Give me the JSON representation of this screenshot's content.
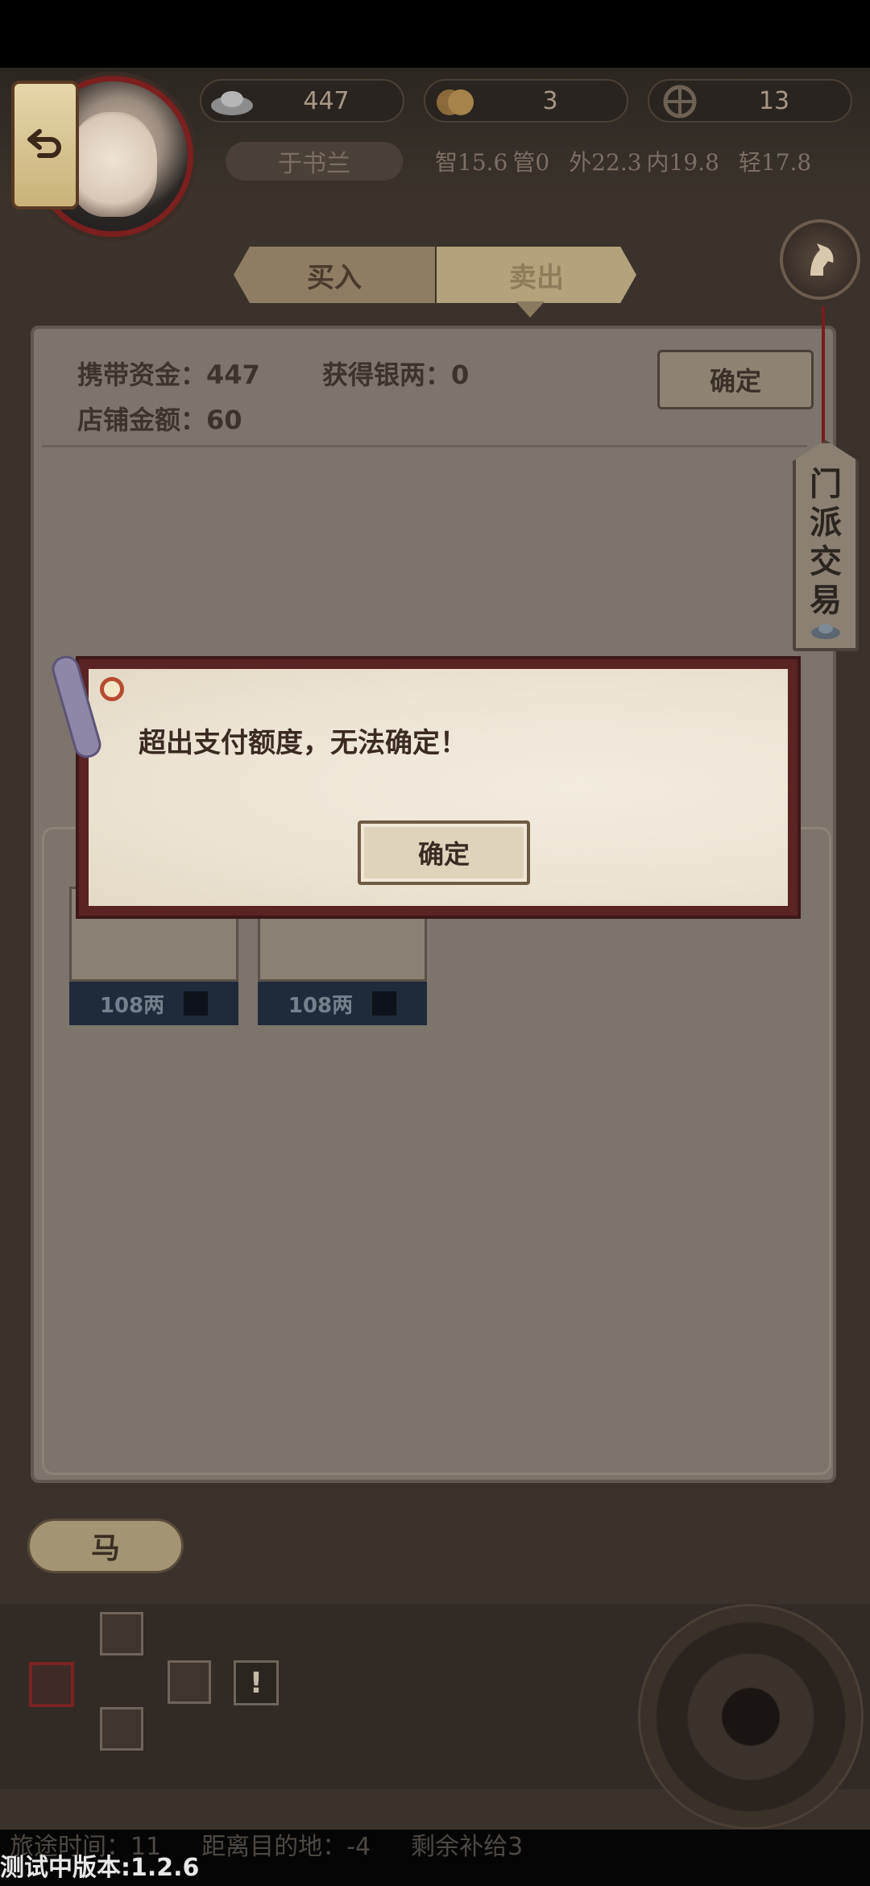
{
  "header": {
    "silver": "447",
    "coins": "3",
    "wheel": "13",
    "player_name": "于书兰",
    "stats": [
      "智15.6",
      "管0",
      "外22.3",
      "内19.8",
      "轻17.8"
    ]
  },
  "tabs": {
    "buy": "买入",
    "sell": "卖出"
  },
  "panel": {
    "carry_funds": "携带资金：447",
    "gain_silver": "获得银两：0",
    "shop_amount": "店铺金额：60",
    "confirm": "确定"
  },
  "side_tag": [
    "门",
    "派",
    "交",
    "易"
  ],
  "items": [
    {
      "price": "108两"
    },
    {
      "price": "108两"
    }
  ],
  "horse_tab": "马",
  "route": {
    "warning": "!"
  },
  "footer": {
    "travel_time": "旅途时间：11",
    "distance": "距离目的地：-4",
    "supplies": "剩余补给3",
    "version": "测试中版本:1.2.6"
  },
  "dialog": {
    "message": "超出支付额度，无法确定！",
    "confirm": "确定"
  },
  "colors": {
    "dialog_border": "#5a2424",
    "accent_red": "#7b1f1f",
    "price_bar": "#1f2a3b"
  }
}
